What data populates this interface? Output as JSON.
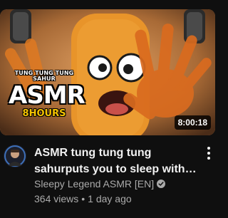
{
  "video": {
    "thumbnail": {
      "caption_line1": "TUNG TUNG TUNG SAHUR",
      "caption_line2": "ASMR",
      "caption_line3": "8HOURS",
      "duration": "8:00:18",
      "colors": {
        "background": "#bf7a3c",
        "character": "#e8942a",
        "hours_text": "#f5c400"
      }
    },
    "title": "ASMR tung tung tung sahurputs you to sleep with mouth soun…",
    "channel": {
      "name": "Sleepy Legend ASMR [EN]",
      "verified_icon": "check-circle-icon"
    },
    "views": "364 views",
    "separator": "•",
    "age": "1 day ago",
    "menu_icon": "more-vert-icon"
  },
  "colors": {
    "page_background": "#0f0f0f",
    "title_text": "#f1f1f1",
    "meta_text": "#aaaaaa"
  }
}
